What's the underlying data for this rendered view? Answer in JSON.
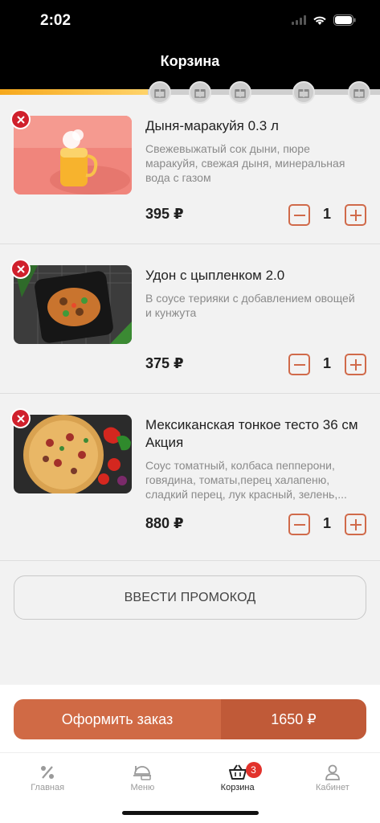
{
  "status": {
    "time": "2:02"
  },
  "header": {
    "title": "Корзина"
  },
  "progress": {
    "fill_fraction": 0.39
  },
  "items": [
    {
      "name": "Дыня-маракуйя 0.3 л",
      "description": "Свежевыжатый сок дыни, пюре маракуйя, свежая дыня, минеральная вода с газом",
      "price": "395 ₽",
      "quantity": "1",
      "image": "melon-passionfruit-drink"
    },
    {
      "name": "Удон с цыпленком 2.0",
      "description": "В соусе терияки с добавлением овощей и кунжута",
      "price": "375 ₽",
      "quantity": "1",
      "image": "udon-chicken"
    },
    {
      "name": "Мексиканская тонкое тесто 36 см Акция",
      "description": "Соус томатный, колбаса пепперони, говядина, томаты,перец халапеню, сладкий перец, лук красный, зелень,...",
      "price": "880 ₽",
      "quantity": "1",
      "image": "mexican-pizza"
    }
  ],
  "promo": {
    "label": "ВВЕСТИ ПРОМОКОД"
  },
  "order": {
    "label": "Оформить заказ",
    "total": "1650 ₽"
  },
  "tabbar": {
    "tabs": [
      {
        "label": "Главная",
        "icon": "percent-icon"
      },
      {
        "label": "Меню",
        "icon": "menu-dish-icon"
      },
      {
        "label": "Корзина",
        "icon": "basket-icon",
        "badge": "3",
        "active": true
      },
      {
        "label": "Кабинет",
        "icon": "user-icon"
      }
    ]
  },
  "colors": {
    "accent": "#d06a45",
    "accent_dark": "#c05a38",
    "remove": "#d0202c",
    "progress": "#f6a81c"
  }
}
